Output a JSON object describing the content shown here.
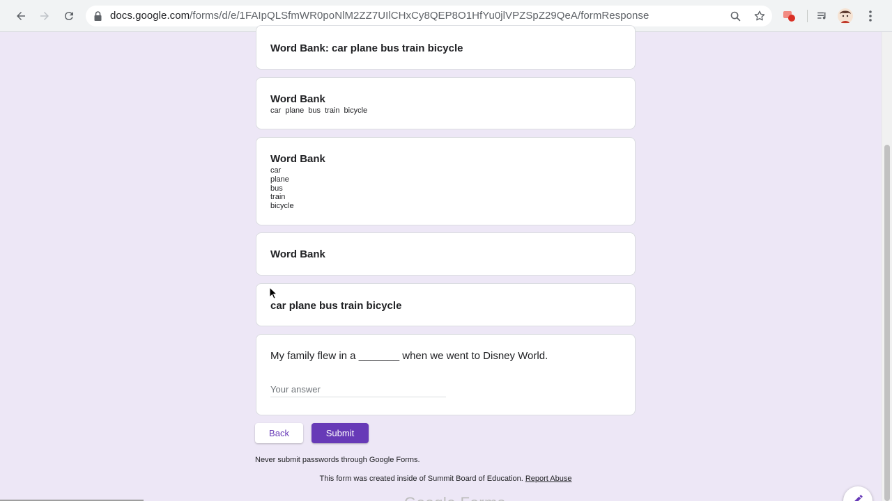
{
  "browser": {
    "url_host": "docs.google.com",
    "url_path": "/forms/d/e/1FAIpQLSfmWR0poNlM2ZZ7UIlCHxCy8QEP8O1HfYu0jlVPZSpZ29QeA/formResponse",
    "icons": [
      "back-icon",
      "forward-icon",
      "reload-icon",
      "lock-icon",
      "zoom-icon",
      "bookmark-star-icon",
      "extension-icon",
      "media-icon",
      "profile-avatar-icon",
      "menu-icon"
    ]
  },
  "cards": {
    "c1": {
      "title": "Word Bank: car plane bus train bicycle"
    },
    "c2": {
      "title": "Word Bank",
      "words": "car plane bus train bicycle"
    },
    "c3": {
      "title": "Word Bank",
      "words": [
        "car",
        "plane",
        "bus",
        "train",
        "bicycle"
      ]
    },
    "c4": {
      "title": "Word Bank"
    },
    "c5": {
      "title": "car plane bus train bicycle"
    },
    "q1": {
      "question": "My family flew in a _______ when we went to Disney World.",
      "placeholder": "Your answer",
      "value": ""
    }
  },
  "actions": {
    "back_label": "Back",
    "submit_label": "Submit"
  },
  "footer": {
    "note": "Never submit passwords through Google Forms.",
    "created_text": "This form was created inside of Summit Board of Education.",
    "report_link": "Report Abuse",
    "logo_text": "Google Forms"
  },
  "colors": {
    "page_bg": "#ede7f6",
    "accent": "#673ab7",
    "card_bg": "#ffffff"
  }
}
